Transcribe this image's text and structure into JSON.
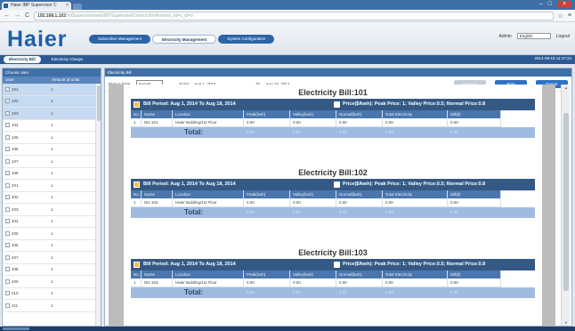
{
  "browser": {
    "tab_title": "Haier IBP Supervisor C",
    "address_host": "192.168.1.102",
    "address_path": "/InfSupervisor/web/IBPSupervisorControl.html#/menu_id=c_id=0"
  },
  "header": {
    "logo": "Haier",
    "nav": [
      "Subscriber Management",
      "Electricity Management",
      "System Configuration"
    ],
    "active_nav": 1,
    "user": "Admin",
    "language": "English",
    "logout": "Logout"
  },
  "subnav": {
    "tabs": [
      "Electricity Bill",
      "Electricity Charge"
    ],
    "active": 0,
    "datetime": "2014-08-18 11:47:24"
  },
  "left": {
    "panel_title": "Choose User",
    "col_user": "User",
    "col_units": "Amount of units",
    "users": [
      {
        "name": "101",
        "units": "1",
        "checked": true
      },
      {
        "name": "102",
        "units": "1",
        "checked": true
      },
      {
        "name": "103",
        "units": "1",
        "checked": true
      },
      {
        "name": "104",
        "units": "1",
        "checked": false
      },
      {
        "name": "105",
        "units": "1",
        "checked": false
      },
      {
        "name": "106",
        "units": "1",
        "checked": false
      },
      {
        "name": "107",
        "units": "1",
        "checked": false
      },
      {
        "name": "108",
        "units": "1",
        "checked": false
      },
      {
        "name": "201",
        "units": "1",
        "checked": false
      },
      {
        "name": "202",
        "units": "1",
        "checked": false
      },
      {
        "name": "203",
        "units": "1",
        "checked": false
      },
      {
        "name": "204",
        "units": "1",
        "checked": false
      },
      {
        "name": "205",
        "units": "1",
        "checked": false
      },
      {
        "name": "206",
        "units": "1",
        "checked": false
      },
      {
        "name": "207",
        "units": "1",
        "checked": false
      },
      {
        "name": "208",
        "units": "1",
        "checked": false
      },
      {
        "name": "209",
        "units": "1",
        "checked": false
      },
      {
        "name": "210",
        "units": "1",
        "checked": false
      },
      {
        "name": "211",
        "units": "1",
        "checked": false
      }
    ]
  },
  "right": {
    "panel_title": "Electricity Bill",
    "pickup_label": "Pickup Date:",
    "pickup_value": "August",
    "from_label": "From:",
    "from_value": "Aug 1, 2014",
    "to_label": "To:",
    "to_value": "Aug 18, 2014",
    "btn_preview": "Preview",
    "btn_print": "Print",
    "btn_export": "Export"
  },
  "bills": [
    {
      "title": "Electricity Bill:101",
      "period": "Bill Period: Aug 1, 2014 To Aug 18, 2014",
      "price": "Price($/kwh): Peak Price: 1; Valley Price:0.5; Normal Price:0.8",
      "row": [
        "1",
        "NO.101",
        "Haier Building/1st Floor",
        "0.00",
        "0.00",
        "0.00",
        "0.00",
        "0.00"
      ],
      "total_label": "Total:",
      "totals": [
        "0.00",
        "0.00",
        "0.00",
        "0.00",
        "0.00"
      ]
    },
    {
      "title": "Electricity Bill:102",
      "period": "Bill Period: Aug 1, 2014 To Aug 18, 2014",
      "price": "Price($/kwh): Peak Price: 1; Valley Price:0.5; Normal Price:0.8",
      "row": [
        "1",
        "NO.102",
        "Haier Building/1st Floor",
        "0.00",
        "0.00",
        "0.00",
        "0.00",
        "0.00"
      ],
      "total_label": "Total:",
      "totals": [
        "0.00",
        "0.00",
        "0.00",
        "0.00",
        "0.00"
      ]
    },
    {
      "title": "Electricity Bill:103",
      "period": "Bill Period: Aug 1, 2014 To Aug 18, 2014",
      "price": "Price($/kwh): Peak Price: 1; Valley Price:0.5; Normal Price:0.8",
      "row": [
        "1",
        "NO.103",
        "Haier Building/1st Floor",
        "0.00",
        "0.00",
        "0.00",
        "0.00",
        "0.00"
      ],
      "total_label": "Total:",
      "totals": [
        "0.00",
        "0.00",
        "0.00",
        "0.00",
        "0.00"
      ]
    }
  ],
  "table_headers": [
    "No.",
    "Name",
    "Location",
    "Peak(kwh)",
    "Valley(kwh)",
    "Normal(kwh)",
    "Total Electricity",
    "Bill($)"
  ]
}
